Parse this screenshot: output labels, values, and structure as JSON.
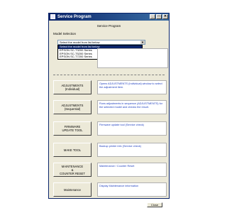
{
  "window": {
    "title": "Service Program",
    "buttons": [
      "_",
      "□",
      "✕"
    ]
  },
  "heading": "Service Program",
  "model_selection": {
    "label": "Model Selection",
    "selected": "Select the model from list below",
    "options": [
      "Select the model from list below",
      "EPSON SC-T3200 Series",
      "EPSON SC-T5200 Series",
      "EPSON SC-T7200 Series"
    ]
  },
  "rows": [
    {
      "button": "ADJUSTMENTS\n(Individual)",
      "info": "Opens ADJUSTMENTS (Individual) window to select the adjustment item."
    },
    {
      "button": "ADJUSTMENTS\n(Sequential)",
      "info": "Runs adjustments in sequence (ADJUSTMENTS) for the selected model and checks the result."
    },
    {
      "button": "FIRMWARE\nUPDATE TOOL",
      "info": "Firmware update tool (Service check)"
    },
    {
      "button": "MAKE TOOL",
      "info": "Backup printer info (Service check)"
    },
    {
      "button": "MAINTENANCE\n&\nCOUNTER RESET",
      "info": "Maintenance / Counter Reset"
    },
    {
      "button": "Maintenance",
      "info": "Display Maintenance information"
    }
  ],
  "close_label": "Close",
  "colors": {
    "title_bar": "#0a246a",
    "highlight": "#0a246a",
    "link_text": "#1f3fbf",
    "window_bg": "#ece9d8"
  }
}
